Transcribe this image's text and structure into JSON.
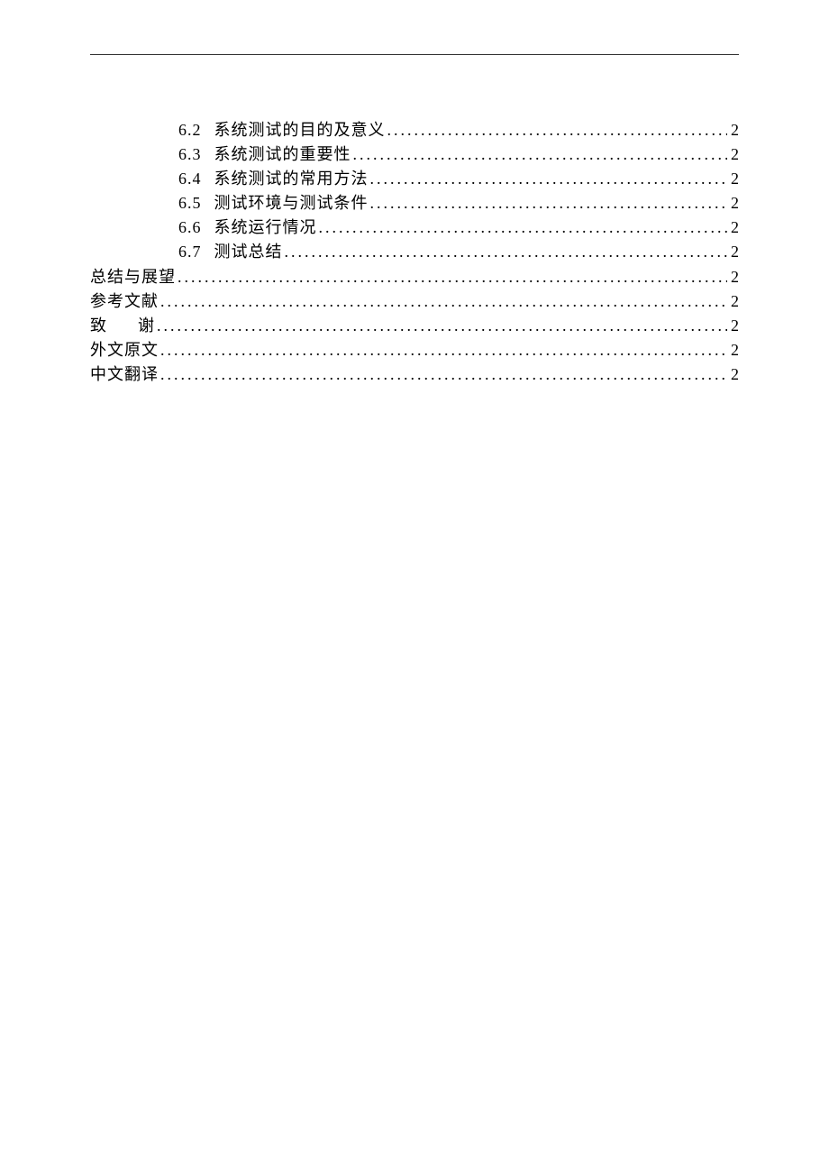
{
  "toc_sub": [
    {
      "num": "6.2",
      "title": "系统测试的目的及意义",
      "page": "2"
    },
    {
      "num": "6.3",
      "title": "系统测试的重要性",
      "page": "2"
    },
    {
      "num": "6.4",
      "title": "系统测试的常用方法",
      "page": "2"
    },
    {
      "num": "6.5",
      "title": "测试环境与测试条件",
      "page": "2"
    },
    {
      "num": "6.6",
      "title": "系统运行情况",
      "page": "2"
    },
    {
      "num": "6.7",
      "title": "测试总结",
      "page": "2"
    }
  ],
  "toc_top": [
    {
      "title": "总结与展望",
      "page": "2"
    },
    {
      "title": "参考文献",
      "page": "2"
    },
    {
      "title_spaced": {
        "ch1": "致",
        "ch2": "谢"
      },
      "page": "2"
    },
    {
      "title": "外文原文",
      "page": "2"
    },
    {
      "title": "中文翻译",
      "page": "2"
    }
  ]
}
